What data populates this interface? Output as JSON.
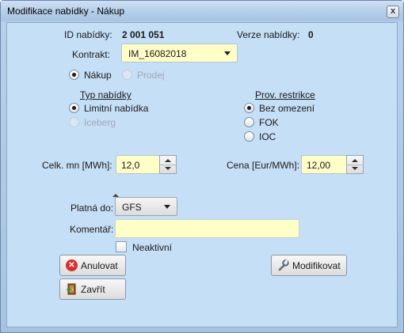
{
  "window": {
    "title": "Modifikace nabídky - Nákup",
    "close_glyph": "x"
  },
  "header": {
    "id_label": "ID nabídky:",
    "id_value": "2 001 051",
    "version_label": "Verze nabídky:",
    "version_value": "0"
  },
  "contract": {
    "label": "Kontrakt:",
    "value": "IM_16082018"
  },
  "side": {
    "buy_label": "Nákup",
    "sell_label": "Prodej",
    "selected": "Nákup"
  },
  "offer_type": {
    "heading": "Typ nabídky",
    "options": [
      "Limitní nabídka",
      "Iceberg"
    ],
    "selected": "Limitní nabídka"
  },
  "restrictions": {
    "heading": "Prov. restrikce",
    "options": [
      "Bez omezení",
      "FOK",
      "IOC"
    ],
    "selected": "Bez omezení"
  },
  "quantity": {
    "label": "Celk. mn [MWh]:",
    "value": "12,0"
  },
  "price": {
    "label": "Cena [Eur/MWh]:",
    "value": "12,00"
  },
  "validity": {
    "label": "Platná do:",
    "value": "GFS"
  },
  "comment": {
    "label": "Komentář:",
    "value": ""
  },
  "inactive": {
    "label": "Neaktivní",
    "checked": false
  },
  "buttons": {
    "cancel": "Anulovat",
    "close": "Zavřít",
    "modify": "Modifikovat"
  },
  "icons": {
    "cancel": "cancel-x-icon",
    "close": "door-exit-icon",
    "modify": "wrench-icon"
  },
  "colors": {
    "client_bg": "#c5dff7",
    "input_bg": "#ffffc8",
    "cancel_icon": "#d7302b"
  }
}
